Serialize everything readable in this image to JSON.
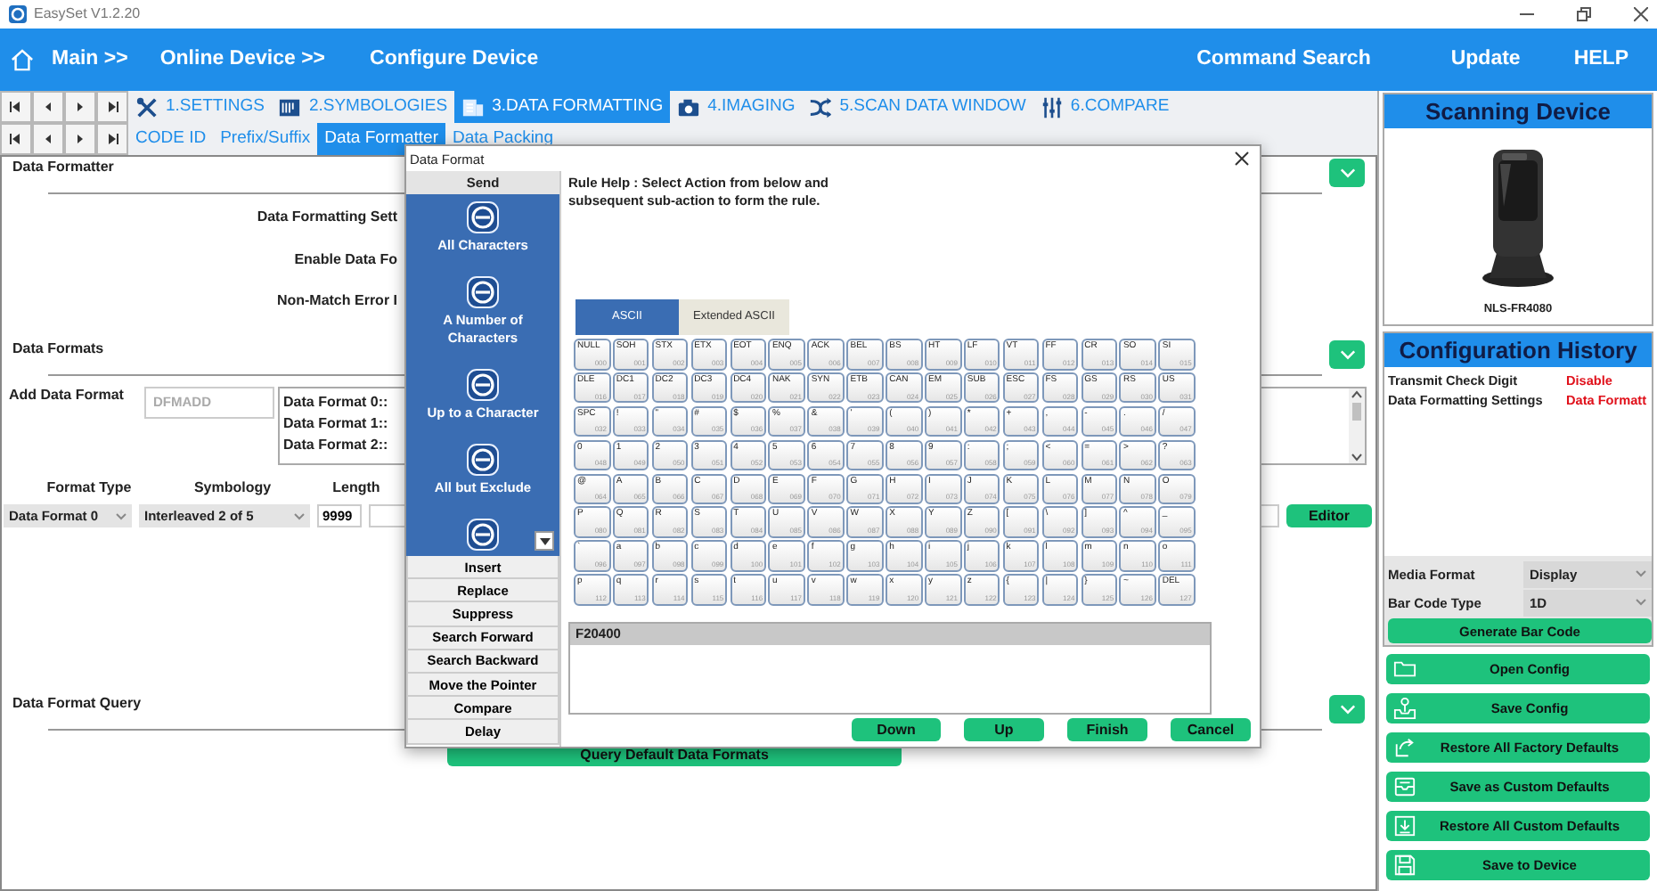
{
  "window": {
    "title": "EasySet V1.2.20"
  },
  "nav": {
    "breadcrumbs": [
      "Main >>",
      "Online Device >>",
      "Configure Device"
    ],
    "links": [
      "Command Search",
      "Update",
      "HELP"
    ]
  },
  "main_tabs": [
    {
      "label": "1.SETTINGS",
      "selected": false
    },
    {
      "label": "2.SYMBOLOGIES",
      "selected": false
    },
    {
      "label": "3.DATA FORMATTING",
      "selected": true
    },
    {
      "label": "4.IMAGING",
      "selected": false
    },
    {
      "label": "5.SCAN DATA WINDOW",
      "selected": false
    },
    {
      "label": "6.COMPARE",
      "selected": false
    }
  ],
  "sub_tabs": [
    {
      "label": "CODE ID",
      "selected": false
    },
    {
      "label": "Prefix/Suffix",
      "selected": false
    },
    {
      "label": "Data Formatter",
      "selected": true
    },
    {
      "label": "Data Packing",
      "selected": false
    }
  ],
  "formatter_section": {
    "title": "Data Formatter",
    "labels": [
      "Data Formatting Sett",
      "Enable Data Fo",
      "Non-Match Error I"
    ]
  },
  "formats_section": {
    "title": "Data Formats",
    "add_label": "Add Data Format",
    "add_field": {
      "placeholder": "DFMADD"
    },
    "list": [
      "Data Format 0::",
      "Data Format 1::",
      "Data Format 2::"
    ],
    "columns": [
      "Format Type",
      "Symbology",
      "Length"
    ],
    "format_type": "Data Format 0",
    "symbology": "Interleaved 2 of 5",
    "length": "9999",
    "editor_button": "Editor"
  },
  "query_section": {
    "title": "Data Format Query",
    "button": "Query Default Data Formats"
  },
  "dialog": {
    "title": "Data Format",
    "action_header": "Send",
    "send_options": [
      "All Characters",
      "A Number of Characters",
      "Up to a Character",
      "All but Exclude"
    ],
    "actions": [
      "Insert",
      "Replace",
      "Suppress",
      "Search Forward",
      "Search Backward",
      "Move the Pointer",
      "Compare",
      "Delay"
    ],
    "help": "Rule Help : Select Action from below and subsequent sub-action to form the rule.",
    "char_tabs": [
      {
        "label": "ASCII",
        "selected": true
      },
      {
        "label": "Extended ASCII",
        "selected": false
      }
    ],
    "keys": [
      {
        "label": "NULL",
        "code": "000"
      },
      {
        "label": "SOH",
        "code": "001"
      },
      {
        "label": "STX",
        "code": "002"
      },
      {
        "label": "ETX",
        "code": "003"
      },
      {
        "label": "EOT",
        "code": "004"
      },
      {
        "label": "ENQ",
        "code": "005"
      },
      {
        "label": "ACK",
        "code": "006"
      },
      {
        "label": "BEL",
        "code": "007"
      },
      {
        "label": "BS",
        "code": "008"
      },
      {
        "label": "HT",
        "code": "009"
      },
      {
        "label": "LF",
        "code": "010"
      },
      {
        "label": "VT",
        "code": "011"
      },
      {
        "label": "FF",
        "code": "012"
      },
      {
        "label": "CR",
        "code": "013"
      },
      {
        "label": "SO",
        "code": "014"
      },
      {
        "label": "SI",
        "code": "015"
      },
      {
        "label": "DLE",
        "code": "016"
      },
      {
        "label": "DC1",
        "code": "017"
      },
      {
        "label": "DC2",
        "code": "018"
      },
      {
        "label": "DC3",
        "code": "019"
      },
      {
        "label": "DC4",
        "code": "020"
      },
      {
        "label": "NAK",
        "code": "021"
      },
      {
        "label": "SYN",
        "code": "022"
      },
      {
        "label": "ETB",
        "code": "023"
      },
      {
        "label": "CAN",
        "code": "024"
      },
      {
        "label": "EM",
        "code": "025"
      },
      {
        "label": "SUB",
        "code": "026"
      },
      {
        "label": "ESC",
        "code": "027"
      },
      {
        "label": "FS",
        "code": "028"
      },
      {
        "label": "GS",
        "code": "029"
      },
      {
        "label": "RS",
        "code": "030"
      },
      {
        "label": "US",
        "code": "031"
      },
      {
        "label": "SPC",
        "code": "032"
      },
      {
        "label": "!",
        "code": "033"
      },
      {
        "label": "\"",
        "code": "034"
      },
      {
        "label": "#",
        "code": "035"
      },
      {
        "label": "$",
        "code": "036"
      },
      {
        "label": "%",
        "code": "037"
      },
      {
        "label": "&",
        "code": "038"
      },
      {
        "label": "'",
        "code": "039"
      },
      {
        "label": "(",
        "code": "040"
      },
      {
        "label": ")",
        "code": "041"
      },
      {
        "label": "*",
        "code": "042"
      },
      {
        "label": "+",
        "code": "043"
      },
      {
        "label": ",",
        "code": "044"
      },
      {
        "label": "-",
        "code": "045"
      },
      {
        "label": ".",
        "code": "046"
      },
      {
        "label": "/",
        "code": "047"
      },
      {
        "label": "0",
        "code": "048"
      },
      {
        "label": "1",
        "code": "049"
      },
      {
        "label": "2",
        "code": "050"
      },
      {
        "label": "3",
        "code": "051"
      },
      {
        "label": "4",
        "code": "052"
      },
      {
        "label": "5",
        "code": "053"
      },
      {
        "label": "6",
        "code": "054"
      },
      {
        "label": "7",
        "code": "055"
      },
      {
        "label": "8",
        "code": "056"
      },
      {
        "label": "9",
        "code": "057"
      },
      {
        "label": ":",
        "code": "058"
      },
      {
        "label": ";",
        "code": "059"
      },
      {
        "label": "<",
        "code": "060"
      },
      {
        "label": "=",
        "code": "061"
      },
      {
        "label": ">",
        "code": "062"
      },
      {
        "label": "?",
        "code": "063"
      },
      {
        "label": "@",
        "code": "064"
      },
      {
        "label": "A",
        "code": "065"
      },
      {
        "label": "B",
        "code": "066"
      },
      {
        "label": "C",
        "code": "067"
      },
      {
        "label": "D",
        "code": "068"
      },
      {
        "label": "E",
        "code": "069"
      },
      {
        "label": "F",
        "code": "070"
      },
      {
        "label": "G",
        "code": "071"
      },
      {
        "label": "H",
        "code": "072"
      },
      {
        "label": "I",
        "code": "073"
      },
      {
        "label": "J",
        "code": "074"
      },
      {
        "label": "K",
        "code": "075"
      },
      {
        "label": "L",
        "code": "076"
      },
      {
        "label": "M",
        "code": "077"
      },
      {
        "label": "N",
        "code": "078"
      },
      {
        "label": "O",
        "code": "079"
      },
      {
        "label": "P",
        "code": "080"
      },
      {
        "label": "Q",
        "code": "081"
      },
      {
        "label": "R",
        "code": "082"
      },
      {
        "label": "S",
        "code": "083"
      },
      {
        "label": "T",
        "code": "084"
      },
      {
        "label": "U",
        "code": "085"
      },
      {
        "label": "V",
        "code": "086"
      },
      {
        "label": "W",
        "code": "087"
      },
      {
        "label": "X",
        "code": "088"
      },
      {
        "label": "Y",
        "code": "089"
      },
      {
        "label": "Z",
        "code": "090"
      },
      {
        "label": "[",
        "code": "091"
      },
      {
        "label": "\\",
        "code": "092"
      },
      {
        "label": "]",
        "code": "093"
      },
      {
        "label": "^",
        "code": "094"
      },
      {
        "label": "_",
        "code": "095"
      },
      {
        "label": "`",
        "code": "096"
      },
      {
        "label": "a",
        "code": "097"
      },
      {
        "label": "b",
        "code": "098"
      },
      {
        "label": "c",
        "code": "099"
      },
      {
        "label": "d",
        "code": "100"
      },
      {
        "label": "e",
        "code": "101"
      },
      {
        "label": "f",
        "code": "102"
      },
      {
        "label": "g",
        "code": "103"
      },
      {
        "label": "h",
        "code": "104"
      },
      {
        "label": "i",
        "code": "105"
      },
      {
        "label": "j",
        "code": "106"
      },
      {
        "label": "k",
        "code": "107"
      },
      {
        "label": "l",
        "code": "108"
      },
      {
        "label": "m",
        "code": "109"
      },
      {
        "label": "n",
        "code": "110"
      },
      {
        "label": "o",
        "code": "111"
      },
      {
        "label": "p",
        "code": "112"
      },
      {
        "label": "q",
        "code": "113"
      },
      {
        "label": "r",
        "code": "114"
      },
      {
        "label": "s",
        "code": "115"
      },
      {
        "label": "t",
        "code": "116"
      },
      {
        "label": "u",
        "code": "117"
      },
      {
        "label": "v",
        "code": "118"
      },
      {
        "label": "w",
        "code": "119"
      },
      {
        "label": "x",
        "code": "120"
      },
      {
        "label": "y",
        "code": "121"
      },
      {
        "label": "z",
        "code": "122"
      },
      {
        "label": "{",
        "code": "123"
      },
      {
        "label": "|",
        "code": "124"
      },
      {
        "label": "}",
        "code": "125"
      },
      {
        "label": "~",
        "code": "126"
      },
      {
        "label": "DEL",
        "code": "127"
      }
    ],
    "rule_header": "F20400",
    "buttons": [
      "Down",
      "Up",
      "Finish",
      "Cancel"
    ]
  },
  "device": {
    "title": "Scanning Device",
    "model": "NLS-FR4080"
  },
  "history": {
    "title": "Configuration History",
    "rows": [
      {
        "setting": "Transmit Check Digit",
        "value": "Disable"
      },
      {
        "setting": "Data Formatting Settings",
        "value": "Data Formatt"
      }
    ]
  },
  "barcode": {
    "media_label": "Media Format",
    "media_value": "Display",
    "type_label": "Bar Code Type",
    "type_value": "1D",
    "button": "Generate Bar Code"
  },
  "actions": [
    "Open Config",
    "Save Config",
    "Restore All Factory Defaults",
    "Save as Custom Defaults",
    "Restore All Custom Defaults",
    "Save to Device"
  ]
}
